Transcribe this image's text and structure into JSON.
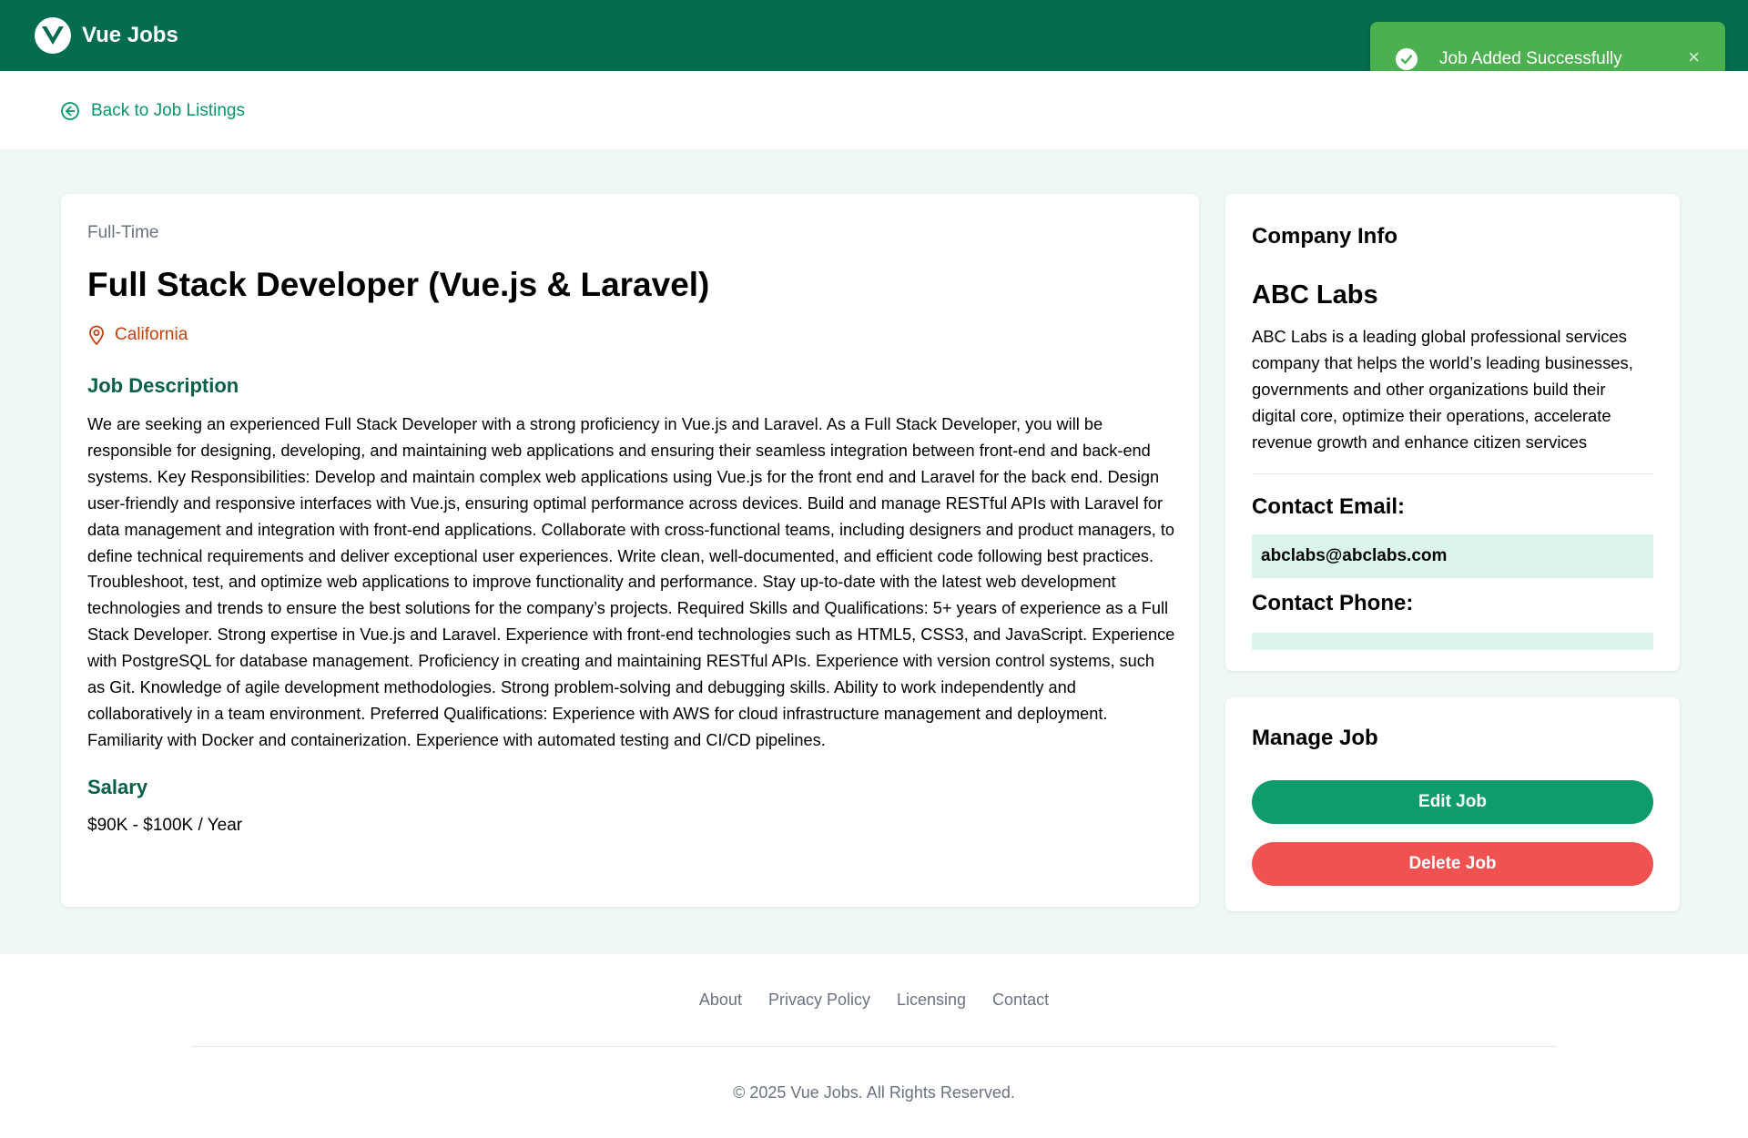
{
  "header": {
    "brand": "Vue Jobs",
    "color": "#046c4e"
  },
  "toast": {
    "message": "Job Added Successfully",
    "close_glyph": "×",
    "icon": "check-circle-icon",
    "color": "#4caf50"
  },
  "nav": {
    "back_label": "Back to Job Listings",
    "icon": "arrow-left-circle-icon"
  },
  "job": {
    "type": "Full-Time",
    "title": "Full Stack Developer (Vue.js & Laravel)",
    "location": "California",
    "location_icon": "map-pin-icon",
    "description_heading": "Job Description",
    "description": "We are seeking an experienced Full Stack Developer with a strong proficiency in Vue.js and Laravel. As a Full Stack Developer, you will be responsible for designing, developing, and maintaining web applications and ensuring their seamless integration between front-end and back-end systems. Key Responsibilities: Develop and maintain complex web applications using Vue.js for the front end and Laravel for the back end. Design user-friendly and responsive interfaces with Vue.js, ensuring optimal performance across devices. Build and manage RESTful APIs with Laravel for data management and integration with front-end applications. Collaborate with cross-functional teams, including designers and product managers, to define technical requirements and deliver exceptional user experiences. Write clean, well-documented, and efficient code following best practices. Troubleshoot, test, and optimize web applications to improve functionality and performance. Stay up-to-date with the latest web development technologies and trends to ensure the best solutions for the company’s projects. Required Skills and Qualifications: 5+ years of experience as a Full Stack Developer. Strong expertise in Vue.js and Laravel. Experience with front-end technologies such as HTML5, CSS3, and JavaScript. Experience with PostgreSQL for database management. Proficiency in creating and maintaining RESTful APIs. Experience with version control systems, such as Git. Knowledge of agile development methodologies. Strong problem-solving and debugging skills. Ability to work independently and collaboratively in a team environment. Preferred Qualifications: Experience with AWS for cloud infrastructure management and deployment. Familiarity with Docker and containerization. Experience with automated testing and CI/CD pipelines.",
    "salary_heading": "Salary",
    "salary": "$90K - $100K / Year"
  },
  "company": {
    "heading": "Company Info",
    "name": "ABC Labs",
    "description": "ABC Labs is a leading global professional services company that helps the world’s leading businesses, governments and other organizations build their digital core, optimize their operations, accelerate revenue growth and enhance citizen services",
    "email_label": "Contact Email:",
    "email": "abclabs@abclabs.com",
    "phone_label": "Contact Phone:",
    "phone": ""
  },
  "manage": {
    "heading": "Manage Job",
    "edit_label": "Edit Job",
    "delete_label": "Delete Job",
    "edit_color": "#0e9b6e",
    "delete_color": "#f05252"
  },
  "footer": {
    "links": [
      "About",
      "Privacy Policy",
      "Licensing",
      "Contact"
    ],
    "copyright": "© 2025 Vue Jobs. All Rights Reserved."
  }
}
